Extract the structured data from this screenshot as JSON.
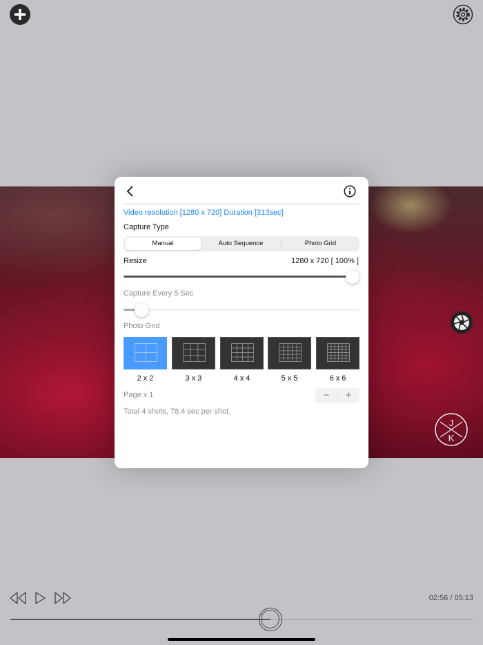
{
  "top": {
    "add_icon": "plus-circle-icon",
    "settings_icon": "gear-icon"
  },
  "modal": {
    "video_info": "Video resolution [1280 x 720] Duration [313sec]",
    "capture_type_label": "Capture Type",
    "segments": [
      "Manual",
      "Auto Sequence",
      "Photo Grid"
    ],
    "selected_segment": "Manual",
    "resize_label": "Resize",
    "resize_value": "1280 x 720 [ 100% ]",
    "resize_fraction": 1.0,
    "capture_every_label": "Capture Every 5 Sec",
    "capture_every_fraction": 0.05,
    "photo_grid_label": "Photo Grid",
    "grids": [
      {
        "label": "2 x 2",
        "n": 2
      },
      {
        "label": "3 x 3",
        "n": 3
      },
      {
        "label": "4 x 4",
        "n": 4
      },
      {
        "label": "5 x 5",
        "n": 5
      },
      {
        "label": "6 x 6",
        "n": 6
      }
    ],
    "selected_grid": "2 x 2",
    "page_label": "Page x 1",
    "stepper_minus": "−",
    "stepper_plus": "+",
    "summary": "Total 4 shots, 78.4 sec per shot."
  },
  "overlay": {
    "shutter_icon": "camera-shutter-icon",
    "logo_text": "JK"
  },
  "player": {
    "time": "02:56 / 05:13",
    "progress_fraction": 0.562
  },
  "colors": {
    "accent": "#1a84ff",
    "selected_grid": "#4a9bff"
  }
}
